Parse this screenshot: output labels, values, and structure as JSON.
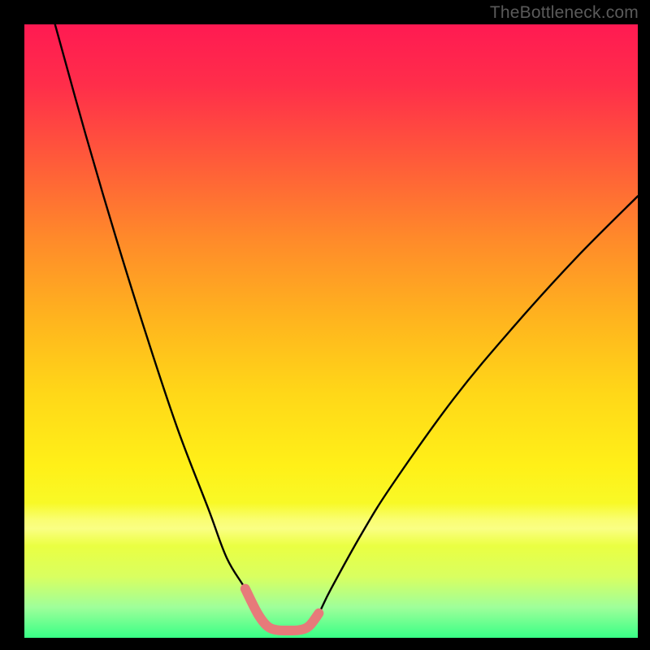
{
  "watermark": {
    "text": "TheBottleneck.com"
  },
  "chart_data": {
    "type": "line",
    "title": "",
    "xlabel": "",
    "ylabel": "",
    "xlim": [
      0,
      100
    ],
    "ylim": [
      0,
      100
    ],
    "grid": false,
    "legend": false,
    "series": [
      {
        "name": "left-curve",
        "color": "#000000",
        "x": [
          5,
          10,
          15,
          20,
          25,
          30,
          33,
          36,
          38,
          39.5
        ],
        "values": [
          100,
          82,
          65,
          49,
          34,
          21,
          13,
          8,
          4,
          2
        ]
      },
      {
        "name": "right-curve",
        "color": "#000000",
        "x": [
          46.5,
          48,
          50,
          55,
          60,
          70,
          80,
          90,
          100
        ],
        "values": [
          2,
          4,
          8,
          17,
          25,
          39,
          51,
          62,
          72
        ]
      },
      {
        "name": "valley-highlight",
        "color": "#e77a7a",
        "x": [
          36,
          38,
          39.5,
          41,
          43,
          45,
          46.5,
          48
        ],
        "values": [
          8,
          4,
          2,
          1.3,
          1.2,
          1.3,
          2,
          4
        ]
      }
    ],
    "background_gradient": {
      "top": "#ff1a52",
      "mid": "#fff018",
      "bottom": "#38ff86"
    }
  }
}
